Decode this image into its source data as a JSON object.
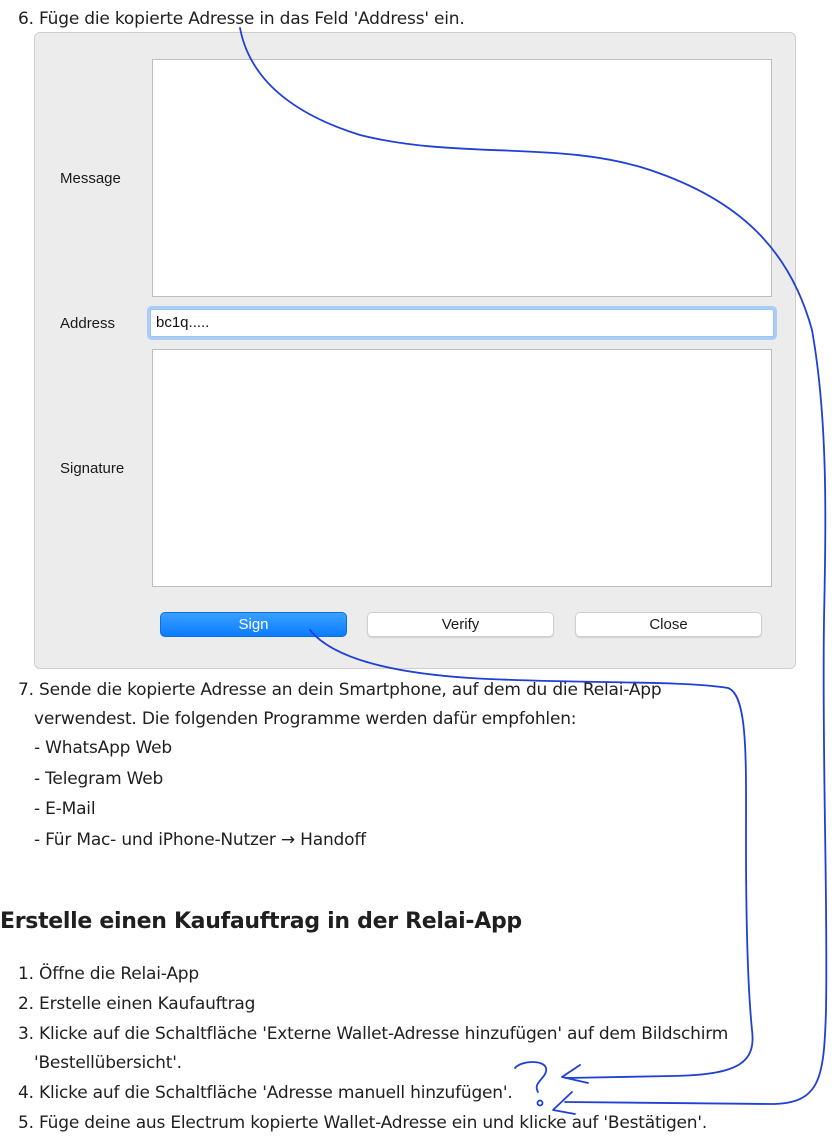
{
  "steps_top": {
    "step6": "6. Füge die kopierte Adresse in das Feld 'Address' ein."
  },
  "dialog": {
    "message_label": "Message",
    "address_label": "Address",
    "address_value": "bc1q.....",
    "signature_label": "Signature",
    "sign_button": "Sign",
    "verify_button": "Verify",
    "close_button": "Close"
  },
  "step7": {
    "line1": "7. Sende die kopierte Adresse an dein Smartphone, auf dem du die Relai-App",
    "line2": "verwendest. Die folgenden Programme werden dafür empfohlen:",
    "options": [
      "- WhatsApp Web",
      "- Telegram Web",
      "- E-Mail",
      "- Für Mac- und iPhone-Nutzer → Handoff"
    ]
  },
  "section_heading": "Erstelle einen Kaufauftrag in der Relai-App",
  "steps_bottom": [
    "1. Öffne die Relai-App",
    "2. Erstelle einen Kaufauftrag",
    "3. Klicke auf die Schaltfläche 'Externe Wallet-Adresse hinzufügen' auf dem Bildschirm",
    "'Bestellübersicht'.",
    "4. Klicke auf die Schaltfläche 'Adresse manuell hinzufügen'.",
    "5. Füge deine aus Electrum kopierte Wallet-Adresse ein und klicke auf 'Bestätigen'."
  ],
  "annotation": {
    "ink_color": "#1f3fd6",
    "handwritten_mark": "?"
  }
}
